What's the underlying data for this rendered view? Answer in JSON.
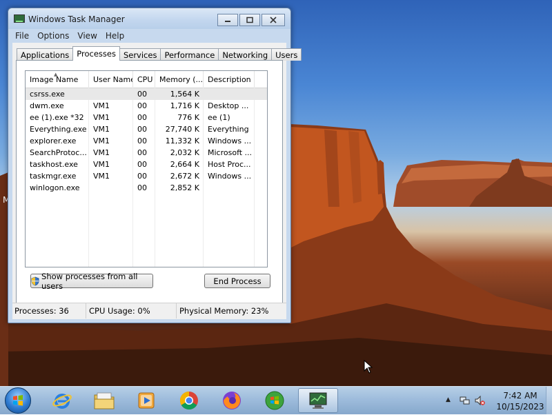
{
  "window": {
    "title": "Windows Task Manager",
    "menu": [
      "File",
      "Options",
      "View",
      "Help"
    ],
    "tabs": [
      {
        "label": "Applications"
      },
      {
        "label": "Processes"
      },
      {
        "label": "Services"
      },
      {
        "label": "Performance"
      },
      {
        "label": "Networking"
      },
      {
        "label": "Users"
      }
    ],
    "active_tab": "Processes"
  },
  "process_table": {
    "columns": [
      "Image Name",
      "User Name",
      "CPU",
      "Memory (...",
      "Description"
    ],
    "rows": [
      {
        "image": "csrss.exe",
        "user": "",
        "cpu": "00",
        "memory": "1,564 K",
        "description": ""
      },
      {
        "image": "dwm.exe",
        "user": "VM1",
        "cpu": "00",
        "memory": "1,716 K",
        "description": "Desktop ..."
      },
      {
        "image": "ee (1).exe *32",
        "user": "VM1",
        "cpu": "00",
        "memory": "776 K",
        "description": "ee (1)"
      },
      {
        "image": "Everything.exe",
        "user": "VM1",
        "cpu": "00",
        "memory": "27,740 K",
        "description": "Everything"
      },
      {
        "image": "explorer.exe",
        "user": "VM1",
        "cpu": "00",
        "memory": "11,332 K",
        "description": "Windows ..."
      },
      {
        "image": "SearchProtoc...",
        "user": "VM1",
        "cpu": "00",
        "memory": "2,032 K",
        "description": "Microsoft ..."
      },
      {
        "image": "taskhost.exe",
        "user": "VM1",
        "cpu": "00",
        "memory": "2,664 K",
        "description": "Host Proc..."
      },
      {
        "image": "taskmgr.exe",
        "user": "VM1",
        "cpu": "00",
        "memory": "2,672 K",
        "description": "Windows ..."
      },
      {
        "image": "winlogon.exe",
        "user": "",
        "cpu": "00",
        "memory": "2,852 K",
        "description": ""
      }
    ],
    "selected_row": 0
  },
  "buttons": {
    "show_all": "Show processes from all users",
    "end_process": "End Process"
  },
  "status": {
    "processes": "Processes: 36",
    "cpu": "CPU Usage: 0%",
    "memory": "Physical Memory: 23%"
  },
  "desktop": {
    "stray_text": "M"
  },
  "taskbar": {
    "pinned": [
      {
        "name": "internet-explorer-icon"
      },
      {
        "name": "file-explorer-icon"
      },
      {
        "name": "media-player-icon"
      },
      {
        "name": "chrome-icon"
      },
      {
        "name": "firefox-icon"
      },
      {
        "name": "windows-media-center-icon"
      },
      {
        "name": "task-manager-icon"
      }
    ],
    "clock_time": "7:42 AM",
    "clock_date": "10/15/2023"
  },
  "colors": {
    "accent": "#3a6fb0",
    "window_frame": "#c7d9ee",
    "selection": "#e8e8e8"
  }
}
